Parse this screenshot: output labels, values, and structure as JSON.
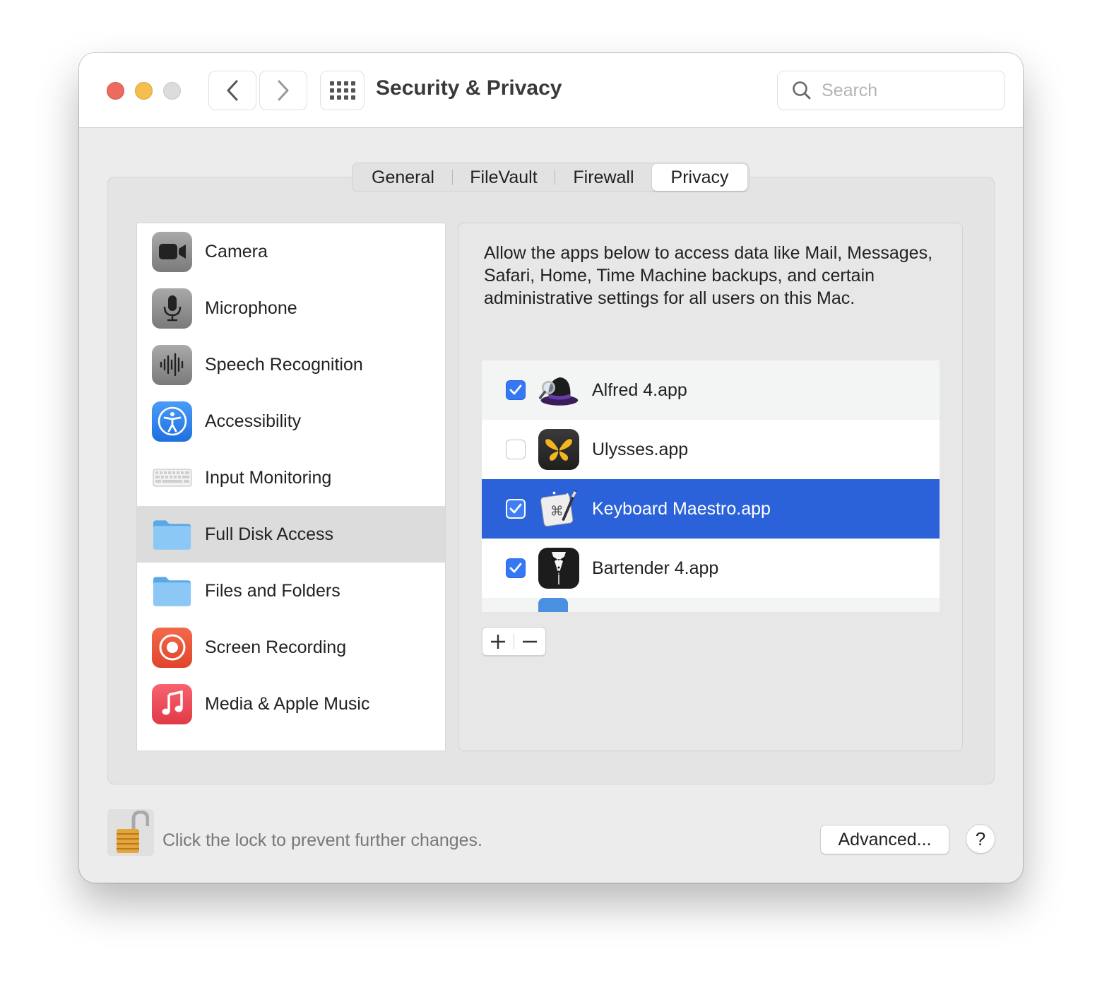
{
  "window": {
    "title": "Security & Privacy",
    "search_placeholder": "Search"
  },
  "tabs": [
    {
      "label": "General",
      "selected": false
    },
    {
      "label": "FileVault",
      "selected": false
    },
    {
      "label": "Firewall",
      "selected": false
    },
    {
      "label": "Privacy",
      "selected": true
    }
  ],
  "sidebar": {
    "items": [
      {
        "label": "Camera",
        "icon": "camera-icon"
      },
      {
        "label": "Microphone",
        "icon": "microphone-icon"
      },
      {
        "label": "Speech Recognition",
        "icon": "waveform-icon"
      },
      {
        "label": "Accessibility",
        "icon": "accessibility-icon"
      },
      {
        "label": "Input Monitoring",
        "icon": "keyboard-icon"
      },
      {
        "label": "Full Disk Access",
        "icon": "folder-icon",
        "selected": true
      },
      {
        "label": "Files and Folders",
        "icon": "folder-icon"
      },
      {
        "label": "Screen Recording",
        "icon": "screen-record-icon"
      },
      {
        "label": "Media & Apple Music",
        "icon": "music-note-icon"
      }
    ]
  },
  "content": {
    "description": "Allow the apps below to access data like Mail, Messages, Safari, Home, Time Machine backups, and certain administrative settings for all users on this Mac.",
    "apps": [
      {
        "label": "Alfred 4.app",
        "checked": true,
        "icon": "alfred-hat-icon"
      },
      {
        "label": "Ulysses.app",
        "checked": false,
        "icon": "ulysses-butterfly-icon"
      },
      {
        "label": "Keyboard Maestro.app",
        "checked": true,
        "icon": "keyboard-maestro-icon",
        "selected": true
      },
      {
        "label": "Bartender 4.app",
        "checked": true,
        "icon": "bartender-tuxedo-icon"
      }
    ],
    "add_symbol": "+",
    "remove_symbol": "−"
  },
  "footer": {
    "lock_text": "Click the lock to prevent further changes.",
    "advanced_label": "Advanced...",
    "help_label": "?"
  },
  "colors": {
    "accent": "#2c62d9",
    "checkbox": "#3478f6",
    "traffic_red": "#ed6a5e",
    "traffic_yellow": "#f5bf4f"
  }
}
